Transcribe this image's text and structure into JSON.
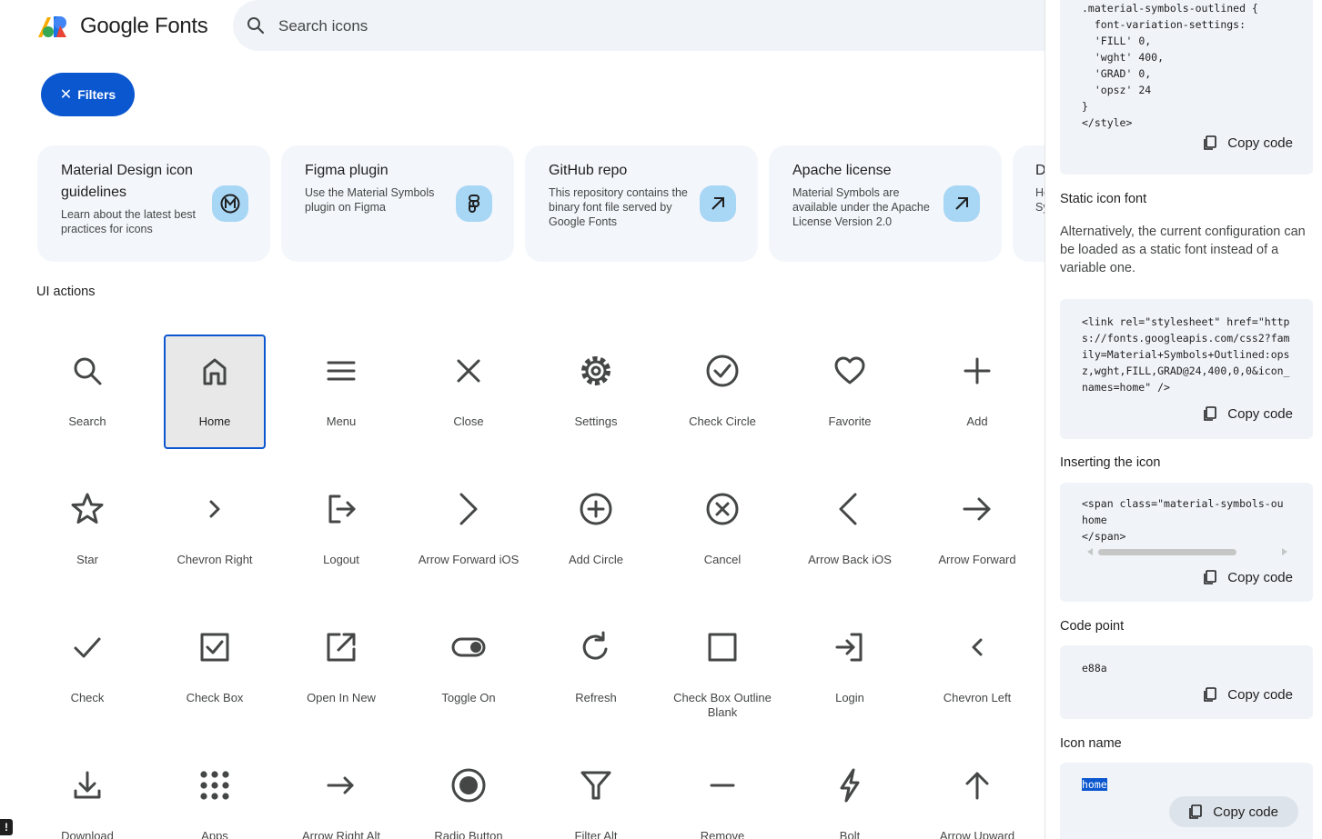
{
  "header": {
    "brand": "Google Fonts",
    "search_placeholder": "Search icons",
    "filters_label": "Filters",
    "filters_close": "✕"
  },
  "cards": [
    {
      "title": "Material Design icon guidelines",
      "desc": "Learn about the latest best practices for icons",
      "icon": "material-logo-icon"
    },
    {
      "title": "Figma plugin",
      "desc": "Use the Material Symbols plugin on Figma",
      "icon": "figma-icon"
    },
    {
      "title": "GitHub repo",
      "desc": "This repository contains the binary font file served by Google Fonts",
      "icon": "arrow-outward-icon"
    },
    {
      "title": "Apache license",
      "desc": "Material Symbols are available under the Apache License Version 2.0",
      "icon": "arrow-outward-icon"
    },
    {
      "title": "D",
      "desc": "He Sy",
      "icon": ""
    }
  ],
  "section_title": "UI actions",
  "icons": [
    {
      "label": "Search",
      "icon": "search"
    },
    {
      "label": "Home",
      "icon": "home",
      "selected": true
    },
    {
      "label": "Menu",
      "icon": "menu"
    },
    {
      "label": "Close",
      "icon": "close"
    },
    {
      "label": "Settings",
      "icon": "settings"
    },
    {
      "label": "Check Circle",
      "icon": "check_circle"
    },
    {
      "label": "Favorite",
      "icon": "favorite"
    },
    {
      "label": "Add",
      "icon": "add"
    },
    {
      "label": "Star",
      "icon": "star"
    },
    {
      "label": "Chevron Right",
      "icon": "chevron_right"
    },
    {
      "label": "Logout",
      "icon": "logout"
    },
    {
      "label": "Arrow Forward iOS",
      "icon": "arrow_forward_ios"
    },
    {
      "label": "Add Circle",
      "icon": "add_circle"
    },
    {
      "label": "Cancel",
      "icon": "cancel"
    },
    {
      "label": "Arrow Back iOS",
      "icon": "arrow_back_ios"
    },
    {
      "label": "Arrow Forward",
      "icon": "arrow_forward"
    },
    {
      "label": "Check",
      "icon": "check"
    },
    {
      "label": "Check Box",
      "icon": "check_box"
    },
    {
      "label": "Open In New",
      "icon": "open_in_new"
    },
    {
      "label": "Toggle On",
      "icon": "toggle_on"
    },
    {
      "label": "Refresh",
      "icon": "refresh"
    },
    {
      "label": "Check Box Outline Blank",
      "icon": "check_box_outline_blank"
    },
    {
      "label": "Login",
      "icon": "login"
    },
    {
      "label": "Chevron Left",
      "icon": "chevron_left"
    },
    {
      "label": "Download",
      "icon": "download"
    },
    {
      "label": "Apps",
      "icon": "apps"
    },
    {
      "label": "Arrow Right Alt",
      "icon": "arrow_right_alt"
    },
    {
      "label": "Radio Button",
      "icon": "radio_button"
    },
    {
      "label": "Filter Alt",
      "icon": "filter_alt"
    },
    {
      "label": "Remove",
      "icon": "remove"
    },
    {
      "label": "Bolt",
      "icon": "bolt"
    },
    {
      "label": "Arrow Upward",
      "icon": "arrow_upward"
    }
  ],
  "error_badge": "!",
  "panel": {
    "css_code": ".material-symbols-outlined {\n  font-variation-settings:\n  'FILL' 0,\n  'wght' 400,\n  'GRAD' 0,\n  'opsz' 24\n}\n</style>",
    "copy_label": "Copy code",
    "static_title": "Static icon font",
    "static_text": "Alternatively, the current configuration can be loaded as a static font instead of a variable one.",
    "static_code": "<link rel=\"stylesheet\" href=\"https://fonts.googleapis.com/css2?family=Material+Symbols+Outlined:opsz,wght,FILL,GRAD@24,400,0,0&icon_names=home\" />",
    "insert_title": "Inserting the icon",
    "insert_code": "<span class=\"material-symbols-ou\nhome\n</span>",
    "codepoint_title": "Code point",
    "codepoint_value": "e88a",
    "iconname_title": "Icon name",
    "iconname_value": "home"
  }
}
